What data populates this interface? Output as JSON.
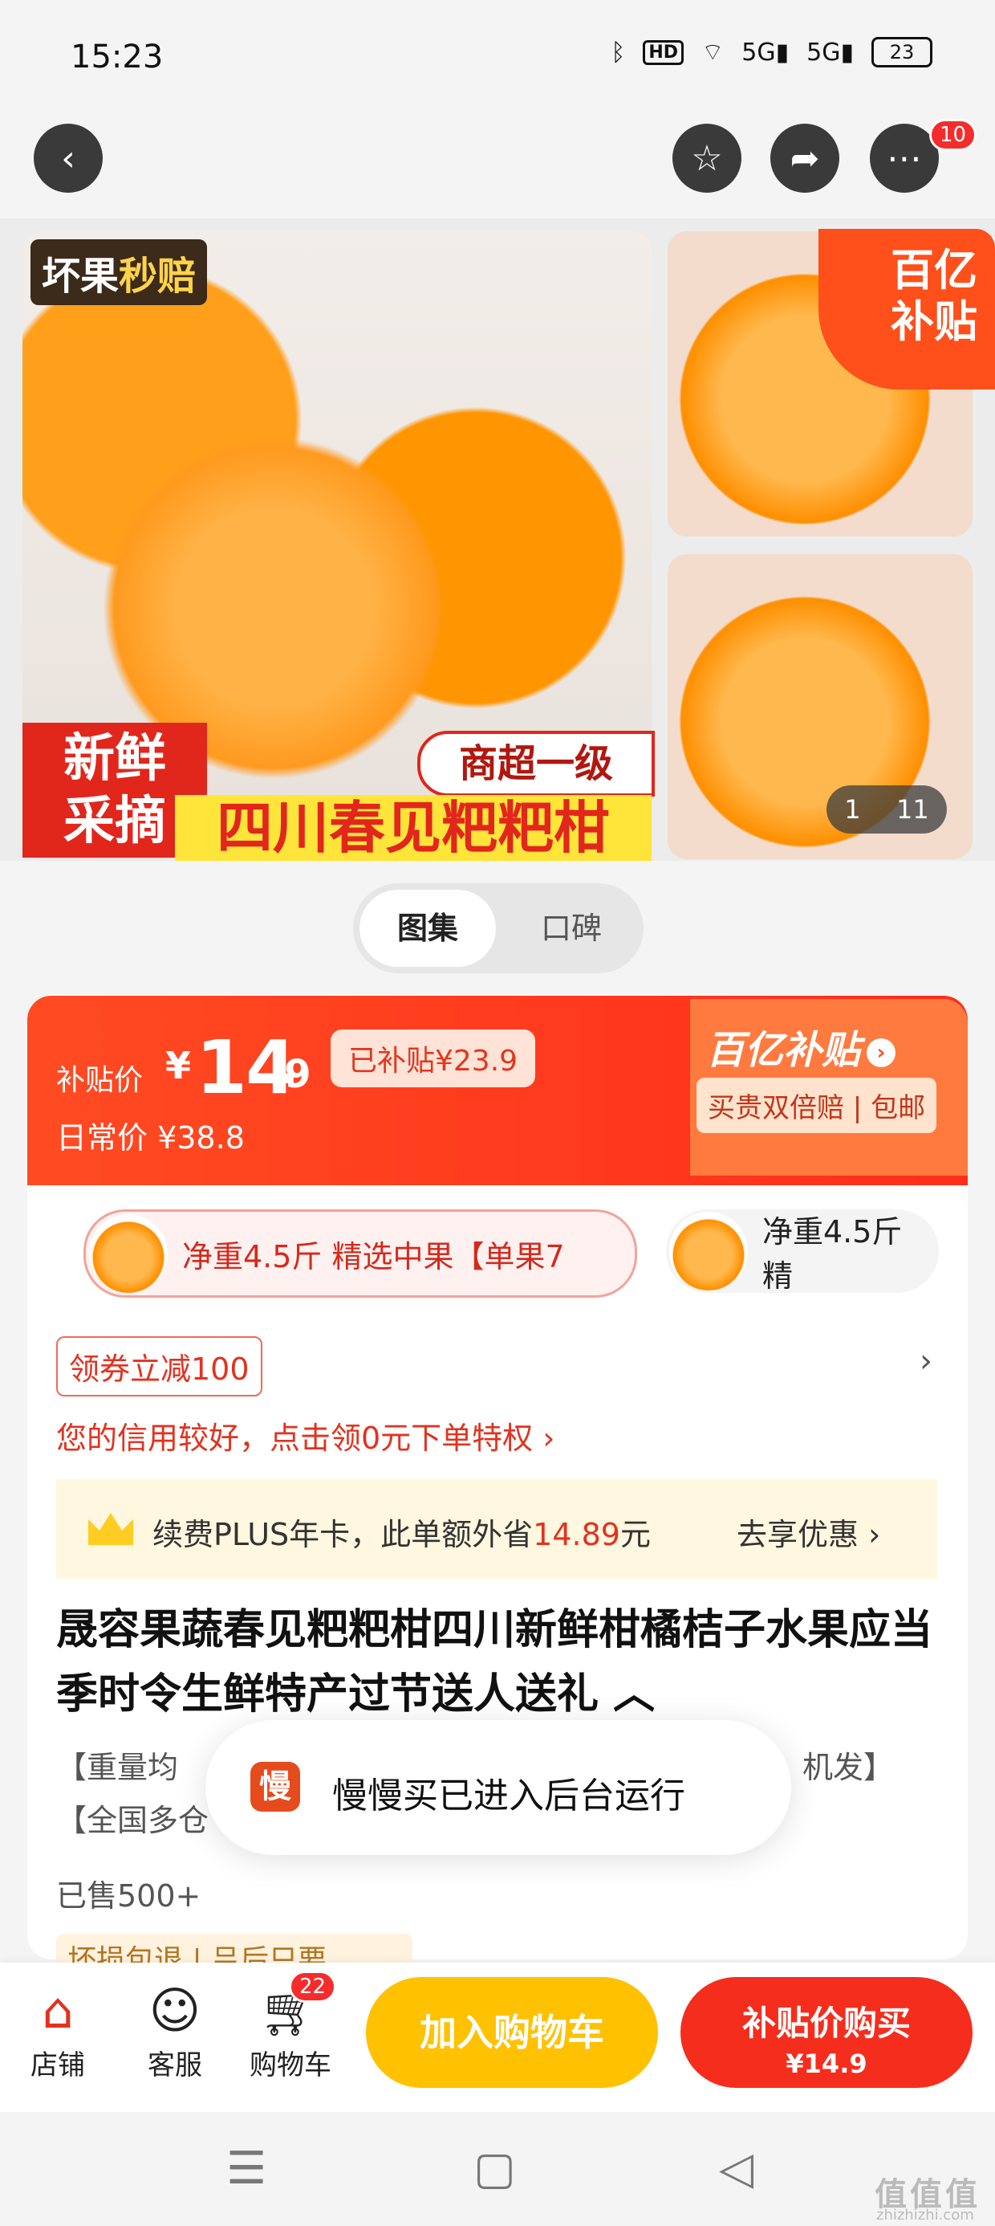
{
  "status": {
    "time": "15:23",
    "net1": "5G",
    "net2": "5G",
    "hd": "HD",
    "battery": "23"
  },
  "top": {
    "notification_count": "10"
  },
  "gallery": {
    "tag_left": "坏果",
    "tag_hl": "秒赔",
    "promo_left": "新鲜\n采摘",
    "promo_bar": "四川春见粑粑柑",
    "promo_grade": "商超一级",
    "subsidy_badge": "百亿\n补贴",
    "counter_current": "1",
    "counter_total": "11"
  },
  "toggle": {
    "on": "图集",
    "off": "口碑"
  },
  "price": {
    "label": "补贴价",
    "yen": "¥",
    "int": "14",
    "dec": ".9",
    "saved": "已补贴¥23.9",
    "daily": "日常价 ¥38.8",
    "brand": "百亿补贴",
    "guarantee": "买贵双倍赔 | 包邮"
  },
  "sku": {
    "active": "净重4.5斤 精选中果【单果7",
    "plain": "净重4.5斤 精"
  },
  "coupon": "领券立减100",
  "credit": "您的信用较好，点击领0元下单特权 ›",
  "plus": {
    "pre": "续费PLUS年卡，此单额外省",
    "amount": "14.89",
    "post": "元",
    "go": "去享优惠 ›"
  },
  "title": "晟容果蔬春见粑粑柑四川新鲜柑橘桔子水果应当季时令生鲜特产过节送人送礼 ︿",
  "desc": {
    "line1_left": "【重量均",
    "line1_right": "机发】",
    "line2": "【全国多仓"
  },
  "sold": "已售500+",
  "service": "坏损包退 | 吕后只要",
  "toast": {
    "icon": "慢",
    "text": "慢慢买已进入后台运行"
  },
  "bottom": {
    "shop": "店铺",
    "service": "客服",
    "cart": "购物车",
    "cart_count": "22",
    "add_cart": "加入购物车",
    "buy": "补贴价购买",
    "buy_price": "¥14.9"
  },
  "watermark": {
    "main": "值值值",
    "sub": "zhizhizhi.com"
  }
}
